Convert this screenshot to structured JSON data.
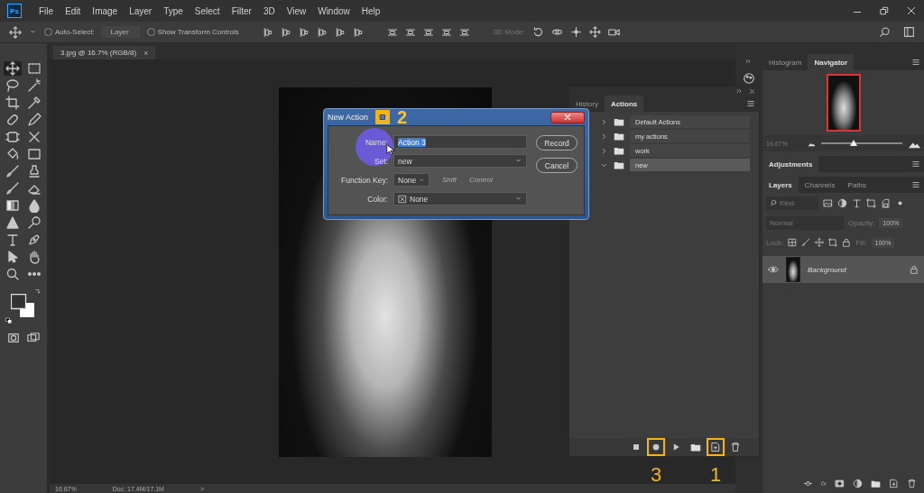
{
  "menu_bar": {
    "logo": "Ps",
    "items": [
      "File",
      "Edit",
      "Image",
      "Layer",
      "Type",
      "Select",
      "Filter",
      "3D",
      "View",
      "Window",
      "Help"
    ]
  },
  "options_bar": {
    "auto_select": {
      "label": "Auto-Select:",
      "checked": false
    },
    "target": "Layer",
    "transform": {
      "label": "Show Transform Controls",
      "checked": false
    },
    "mode": "3D Mode:"
  },
  "tools": [
    {
      "kind": "move",
      "selected": true
    },
    {
      "kind": "marquee",
      "selected": false
    },
    {
      "kind": "lasso",
      "selected": false
    },
    {
      "kind": "wand",
      "selected": false
    },
    {
      "kind": "crop",
      "selected": false
    },
    {
      "kind": "eyedropper",
      "selected": false
    },
    {
      "kind": "bandage",
      "selected": false
    },
    {
      "kind": "pencil",
      "selected": false
    },
    {
      "kind": "frame",
      "selected": false
    },
    {
      "kind": "scissors",
      "selected": false
    },
    {
      "kind": "bucket",
      "selected": false
    },
    {
      "kind": "rectangle",
      "selected": false
    },
    {
      "kind": "brush",
      "selected": false
    },
    {
      "kind": "stamp",
      "selected": false
    },
    {
      "kind": "brush",
      "selected": false
    },
    {
      "kind": "eraser",
      "selected": false
    },
    {
      "kind": "gradient",
      "selected": false
    },
    {
      "kind": "drop",
      "selected": false
    },
    {
      "kind": "triangle",
      "selected": false
    },
    {
      "kind": "lollipop",
      "selected": false
    },
    {
      "kind": "type",
      "selected": false
    },
    {
      "kind": "pen",
      "selected": false
    },
    {
      "kind": "pointer",
      "selected": false
    },
    {
      "kind": "hand",
      "selected": false
    },
    {
      "kind": "zoom",
      "selected": false
    },
    {
      "kind": "dots",
      "selected": false
    }
  ],
  "document": {
    "tab": "3.jpg @ 16.7% (RGB/8)",
    "close": "×"
  },
  "status_bar": {
    "zoom": "16.67%",
    "doc": "Doc: 17.4M/17.1M",
    "more": ">"
  },
  "actions_panel": {
    "tabs": [
      {
        "label": "History",
        "selected": false
      },
      {
        "label": "Actions",
        "selected": true
      }
    ],
    "sets": [
      {
        "name": "Default Actions",
        "expanded": false,
        "selected": false
      },
      {
        "name": "my actions",
        "expanded": false,
        "selected": false
      },
      {
        "name": "work",
        "expanded": false,
        "selected": false
      },
      {
        "name": "new",
        "expanded": true,
        "selected": true
      }
    ],
    "buttons": [
      {
        "kind": "stop"
      },
      {
        "kind": "record",
        "callout": "3"
      },
      {
        "kind": "play"
      },
      {
        "kind": "folder"
      },
      {
        "kind": "new",
        "callout": "1"
      },
      {
        "kind": "delete"
      }
    ]
  },
  "dialog": {
    "title": "New Action",
    "callout": "2",
    "name": {
      "label": "Name:",
      "value": "Action 3",
      "selected": true
    },
    "set": {
      "label": "Set:",
      "value": "new"
    },
    "function_key": {
      "label": "Function Key:",
      "value": "None"
    },
    "modifiers": [
      {
        "label": "Shift",
        "disabled": true
      },
      {
        "label": "Control",
        "disabled": true
      }
    ],
    "color": {
      "label": "Color:",
      "value": "None"
    },
    "buttons": [
      "Record",
      "Cancel"
    ]
  },
  "navigator": {
    "tabs": [
      {
        "label": "Histogram",
        "selected": false
      },
      {
        "label": "Navigator",
        "selected": true
      }
    ],
    "zoom": "16.67%",
    "level": 0.4
  },
  "adjustments": {
    "tabs": [
      {
        "label": "Adjustments",
        "selected": true
      }
    ]
  },
  "layers": {
    "tabs": [
      {
        "label": "Layers",
        "selected": true
      },
      {
        "label": "Channels",
        "selected": false
      },
      {
        "label": "Paths",
        "selected": false
      }
    ],
    "filter": {
      "placeholder": "Kind"
    },
    "blend_mode": "Normal",
    "opacity_label": "Opacity:",
    "opacity": "100%",
    "lock_label": "Lock:",
    "fill_label": "Fill:",
    "fill": "100%",
    "items": [
      {
        "name": "Background",
        "visible": true,
        "locked": true,
        "selected": true
      }
    ],
    "fx": "fx"
  }
}
